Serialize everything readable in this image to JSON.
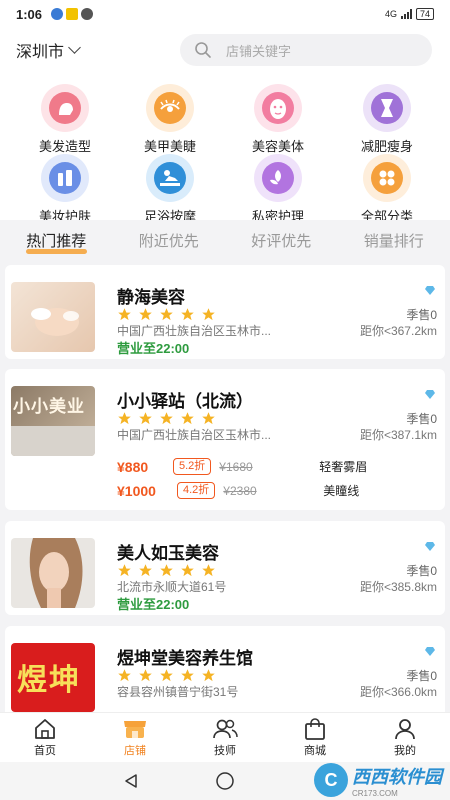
{
  "status_bar": {
    "time": "1:06",
    "network": "4G",
    "battery": "74"
  },
  "header": {
    "city": "深圳市",
    "search_placeholder": "店铺关键字"
  },
  "categories": [
    {
      "label": "美发造型",
      "icon": "hair-styling-icon",
      "color": "#f07a8a",
      "bg": "#fde3e7"
    },
    {
      "label": "美甲美睫",
      "icon": "eyelash-icon",
      "color": "#f5a03c",
      "bg": "#feedd9"
    },
    {
      "label": "美容美体",
      "icon": "face-mask-icon",
      "color": "#f27da0",
      "bg": "#fde2ea"
    },
    {
      "label": "减肥瘦身",
      "icon": "body-slimming-icon",
      "color": "#a072d8",
      "bg": "#ece2f8"
    },
    {
      "label": "美妆护肤",
      "icon": "cosmetics-icon",
      "color": "#6a8fe6",
      "bg": "#e1e9fb"
    },
    {
      "label": "足浴按摩",
      "icon": "massage-icon",
      "color": "#2f8fd8",
      "bg": "#d9ecfb"
    },
    {
      "label": "私密护理",
      "icon": "flower-icon",
      "color": "#b274e0",
      "bg": "#efe2fa"
    },
    {
      "label": "全部分类",
      "icon": "all-categories-icon",
      "color": "#f5a03c",
      "bg": "#feeedb"
    }
  ],
  "tabs": [
    {
      "label": "热门推荐",
      "active": true
    },
    {
      "label": "附近优先",
      "active": false
    },
    {
      "label": "好评优先",
      "active": false
    },
    {
      "label": "销量排行",
      "active": false
    }
  ],
  "shops": [
    {
      "name": "静海美容",
      "rating": 5,
      "sales": "季售0",
      "address": "中国广西壮族自治区玉林市...",
      "distance": "距你<367.2km",
      "hours": "营业至22:00",
      "deals": []
    },
    {
      "name": "小小驿站（北流）",
      "rating": 5,
      "sales": "季售0",
      "address": "中国广西壮族自治区玉林市...",
      "distance": "距你<387.1km",
      "hours": "",
      "thumb_text": "小小美业",
      "deals": [
        {
          "price": "¥880",
          "discount": "5.2折",
          "original": "¥1680",
          "service": "轻奢雾眉"
        },
        {
          "price": "¥1000",
          "discount": "4.2折",
          "original": "¥2380",
          "service": "美瞳线"
        }
      ]
    },
    {
      "name": "美人如玉美容",
      "rating": 5,
      "sales": "季售0",
      "address": "北流市永顺大道61号",
      "distance": "距你<385.8km",
      "hours": "营业至22:00",
      "deals": []
    },
    {
      "name": "煜坤堂美容养生馆",
      "rating": 5,
      "sales": "季售0",
      "address": "容县容州镇普宁街31号",
      "distance": "距你<366.0km",
      "hours": "",
      "thumb_text": "煜坤",
      "deals": []
    }
  ],
  "bottom_nav": [
    {
      "label": "首页",
      "icon": "home-icon",
      "active": false
    },
    {
      "label": "店铺",
      "icon": "store-icon",
      "active": true
    },
    {
      "label": "技师",
      "icon": "technicians-icon",
      "active": false
    },
    {
      "label": "商城",
      "icon": "shopping-bag-icon",
      "active": false
    },
    {
      "label": "我的",
      "icon": "profile-icon",
      "active": false
    }
  ],
  "watermark": {
    "text": "西西软件园",
    "sub": "CR173.COM"
  },
  "colors": {
    "accent": "#f5a033",
    "price": "#f1581f",
    "open": "#2e9b3f"
  }
}
